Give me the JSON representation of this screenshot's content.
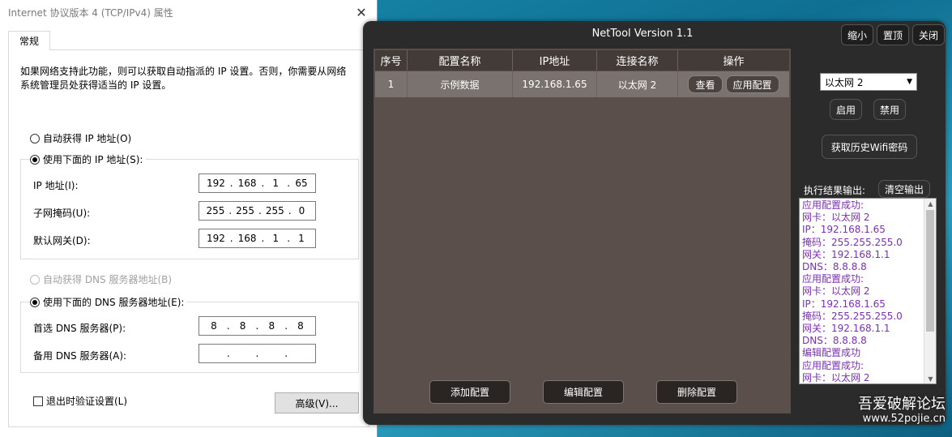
{
  "win": {
    "title": "Internet 协议版本 4 (TCP/IPv4) 属性",
    "close_label": "✕",
    "tab": "常规",
    "intro": "如果网络支持此功能，则可以获取自动指派的 IP 设置。否则，你需要从网络系统管理员处获得适当的 IP 设置。",
    "auto_ip": "自动获得 IP 地址(O)",
    "use_ip": "使用下面的 IP 地址(S):",
    "ip_label": "IP 地址(I):",
    "ip": [
      "192",
      "168",
      "1",
      "65"
    ],
    "mask_label": "子网掩码(U):",
    "mask": [
      "255",
      "255",
      "255",
      "0"
    ],
    "gateway_label": "默认网关(D):",
    "gateway": [
      "192",
      "168",
      "1",
      "1"
    ],
    "auto_dns": "自动获得 DNS 服务器地址(B)",
    "use_dns": "使用下面的 DNS 服务器地址(E):",
    "dns1_label": "首选 DNS 服务器(P):",
    "dns1": [
      "8",
      "8",
      "8",
      "8"
    ],
    "dns2_label": "备用 DNS 服务器(A):",
    "dns2": [
      "",
      "",
      "",
      ""
    ],
    "validate": "退出时验证设置(L)",
    "advanced": "高级(V)..."
  },
  "nettool": {
    "title": "NetTool Version 1.1",
    "btn_min": "缩小",
    "btn_top": "置顶",
    "btn_close": "关闭",
    "columns": [
      "序号",
      "配置名称",
      "IP地址",
      "连接名称",
      "操作"
    ],
    "rows": [
      {
        "index": "1",
        "name": "示例数据",
        "ip": "192.168.1.65",
        "conn": "以太网 2",
        "view": "查看",
        "apply": "应用配置"
      }
    ],
    "btn_add": "添加配置",
    "btn_edit": "编辑配置",
    "btn_delete": "删除配置",
    "nic_selected": "以太网 2",
    "btn_enable": "启用",
    "btn_disable": "禁用",
    "btn_wifi": "获取历史Wifi密码",
    "output_label": "执行结果输出:",
    "btn_clear": "清空输出",
    "output": [
      "应用配置成功:",
      "网卡：以太网 2",
      "IP：192.168.1.65",
      "掩码：255.255.255.0",
      "网关：192.168.1.1",
      "DNS：8.8.8.8",
      "应用配置成功:",
      "网卡：以太网 2",
      "IP：192.168.1.65",
      "掩码：255.255.255.0",
      "网关：192.168.1.1",
      "DNS：8.8.8.8",
      "编辑配置成功",
      "应用配置成功:",
      "网卡：以太网 2"
    ]
  },
  "watermark": {
    "text": "吾爱破解论坛",
    "url": "www.52pojie.cn"
  },
  "colors": {
    "output_text": "#7b2fb5",
    "nettool_bg": "#2b2b2b",
    "table_bg": "#5a4f4a"
  }
}
